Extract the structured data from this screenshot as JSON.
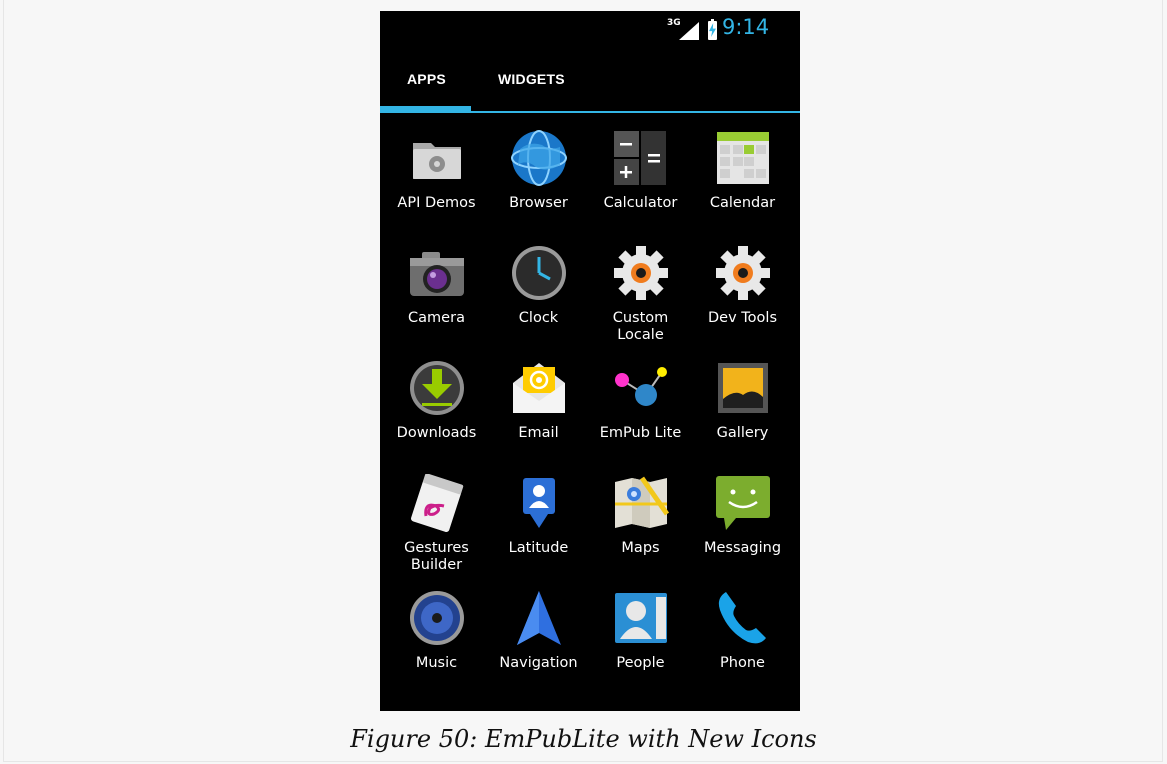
{
  "status_bar": {
    "network": "3G",
    "time": "9:14"
  },
  "tabs": [
    {
      "label": "APPS",
      "selected": true
    },
    {
      "label": "WIDGETS",
      "selected": false
    }
  ],
  "apps": [
    {
      "label": "API Demos",
      "icon": "folder-gear-icon"
    },
    {
      "label": "Browser",
      "icon": "globe-icon"
    },
    {
      "label": "Calculator",
      "icon": "calculator-icon"
    },
    {
      "label": "Calendar",
      "icon": "calendar-icon"
    },
    {
      "label": "Camera",
      "icon": "camera-icon"
    },
    {
      "label": "Clock",
      "icon": "clock-icon"
    },
    {
      "label": "Custom Locale",
      "icon": "gear-icon"
    },
    {
      "label": "Dev Tools",
      "icon": "gear-icon"
    },
    {
      "label": "Downloads",
      "icon": "download-icon"
    },
    {
      "label": "Email",
      "icon": "envelope-icon"
    },
    {
      "label": "EmPub Lite",
      "icon": "molecule-icon"
    },
    {
      "label": "Gallery",
      "icon": "picture-icon"
    },
    {
      "label": "Gestures Builder",
      "icon": "gesture-icon"
    },
    {
      "label": "Latitude",
      "icon": "map-pin-icon"
    },
    {
      "label": "Maps",
      "icon": "map-icon"
    },
    {
      "label": "Messaging",
      "icon": "chat-bubble-icon"
    },
    {
      "label": "Music",
      "icon": "speaker-icon"
    },
    {
      "label": "Navigation",
      "icon": "navigation-arrow-icon"
    },
    {
      "label": "People",
      "icon": "contact-card-icon"
    },
    {
      "label": "Phone",
      "icon": "phone-handset-icon"
    }
  ],
  "caption": "Figure 50: EmPubLite with New Icons"
}
